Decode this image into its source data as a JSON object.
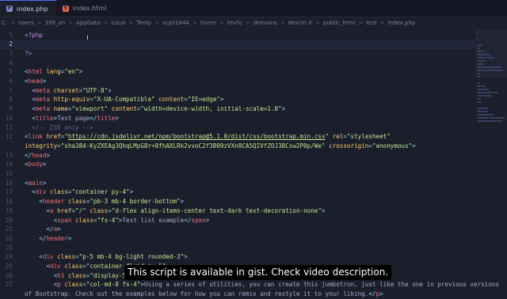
{
  "tabs": [
    {
      "label": "index.php",
      "icon": "php-icon",
      "active": true
    },
    {
      "label": "index.html",
      "icon": "html-icon",
      "active": false
    }
  ],
  "breadcrumb": [
    "C:",
    "Users",
    "399_an",
    "AppData",
    "Local",
    "Temp",
    "scp01644",
    "home",
    "tmrfo",
    "domains",
    "devcm.it",
    "public_html",
    "test",
    "index.php"
  ],
  "lines": [
    {
      "n": "1",
      "html": "<span class='ph'>&lt;?php</span>"
    },
    {
      "n": "2",
      "html": ""
    },
    {
      "n": "3",
      "html": "<span class='ph'>?&gt;</span>"
    },
    {
      "n": "4",
      "html": ""
    },
    {
      "n": "5",
      "html": "<span class='pn'>&lt;</span><span class='tg'>html</span> <span class='at'>lang</span><span class='pn'>=</span><span class='st'>\"en\"</span><span class='pn'>&gt;</span>"
    },
    {
      "n": "6",
      "html": "<span class='pn'>&lt;</span><span class='tg'>head</span><span class='pn'>&gt;</span>"
    },
    {
      "n": "7",
      "html": "  <span class='pn'>&lt;</span><span class='tg'>meta</span> <span class='at'>charset</span><span class='pn'>=</span><span class='st'>\"UTF-8\"</span><span class='pn'>&gt;</span>"
    },
    {
      "n": "8",
      "html": "  <span class='pn'>&lt;</span><span class='tg'>meta</span> <span class='at'>http-equiv</span><span class='pn'>=</span><span class='st'>\"X-UA-Compatible\"</span> <span class='at'>content</span><span class='pn'>=</span><span class='st'>\"IE=edge\"</span><span class='pn'>&gt;</span>"
    },
    {
      "n": "9",
      "html": "  <span class='pn'>&lt;</span><span class='tg'>meta</span> <span class='at'>name</span><span class='pn'>=</span><span class='st'>\"viewport\"</span> <span class='at'>content</span><span class='pn'>=</span><span class='st'>\"width=device-width, initial-scale=1.0\"</span><span class='pn'>&gt;</span>"
    },
    {
      "n": "10",
      "html": "  <span class='pn'>&lt;</span><span class='tg'>title</span><span class='pn'>&gt;</span><span class='tx'>Test page</span><span class='pn'>&lt;/</span><span class='tg'>title</span><span class='pn'>&gt;</span>"
    },
    {
      "n": "11",
      "html": "  <span class='cm'>&lt;!-- CSS only --&gt;</span>"
    },
    {
      "n": "12",
      "html": "<span class='pn'>&lt;</span><span class='tg'>link</span> <span class='at'>href</span><span class='pn'>=</span><span class='st'>\"</span><span class='ul'>https://cdn.jsdelivr.net/npm/bootstrap@5.1.0/dist/css/bootstrap.min.css</span><span class='st'>\"</span> <span class='at'>rel</span><span class='pn'>=</span><span class='st'>\"stylesheet\"</span>"
    },
    {
      "n": "",
      "html": "<span class='at'>integrity</span><span class='pn'>=</span><span class='st'>\"sha384-KyZXEAg3QhqLMpG8r+8fhAXLRk2vvoC2f3B09zVXn8CA5QIVfZOJ3BCsw2P0p/We\"</span> <span class='at'>crossorigin</span><span class='pn'>=</span><span class='st'>\"anonymous\"</span><span class='pn'>&gt;</span>"
    },
    {
      "n": "13",
      "html": "<span class='pn'>&lt;/</span><span class='tg'>head</span><span class='pn'>&gt;</span>"
    },
    {
      "n": "14",
      "html": "<span class='pn'>&lt;</span><span class='tg'>body</span><span class='pn'>&gt;</span>"
    },
    {
      "n": "15",
      "html": ""
    },
    {
      "n": "16",
      "html": "<span class='pn'>&lt;</span><span class='tg'>main</span><span class='pn'>&gt;</span>"
    },
    {
      "n": "17",
      "html": "  <span class='pn'>&lt;</span><span class='tg'>div</span> <span class='at'>class</span><span class='pn'>=</span><span class='st'>\"container py-4\"</span><span class='pn'>&gt;</span>"
    },
    {
      "n": "18",
      "html": "    <span class='pn'>&lt;</span><span class='tg'>header</span> <span class='at'>class</span><span class='pn'>=</span><span class='st'>\"pb-3 mb-4 border-bottom\"</span><span class='pn'>&gt;</span>"
    },
    {
      "n": "19",
      "html": "      <span class='pn'>&lt;</span><span class='tg'>a</span> <span class='at'>href</span><span class='pn'>=</span><span class='st'>\"/\"</span> <span class='at'>class</span><span class='pn'>=</span><span class='st'>\"d-flex align-items-center text-dark text-decoration-none\"</span><span class='pn'>&gt;</span>"
    },
    {
      "n": "20",
      "html": "        <span class='pn'>&lt;</span><span class='tg'>span</span> <span class='at'>class</span><span class='pn'>=</span><span class='st'>\"fs-4\"</span><span class='pn'>&gt;</span><span class='tx'>Test list example</span><span class='pn'>&lt;/</span><span class='tg'>span</span><span class='pn'>&gt;</span>"
    },
    {
      "n": "21",
      "html": "      <span class='pn'>&lt;/</span><span class='tg'>a</span><span class='pn'>&gt;</span>"
    },
    {
      "n": "22",
      "html": "    <span class='pn'>&lt;/</span><span class='tg'>header</span><span class='pn'>&gt;</span>"
    },
    {
      "n": "23",
      "html": ""
    },
    {
      "n": "24",
      "html": "    <span class='pn'>&lt;</span><span class='tg'>div</span> <span class='at'>class</span><span class='pn'>=</span><span class='st'>\"p-5 mb-4 bg-light rounded-3\"</span><span class='pn'>&gt;</span>"
    },
    {
      "n": "25",
      "html": "      <span class='pn'>&lt;</span><span class='tg'>div</span> <span class='at'>class</span><span class='pn'>=</span><span class='st'>\"container-fluid py-5\"</span><span class='pn'>&gt;</span>"
    },
    {
      "n": "26",
      "html": "        <span class='pn'>&lt;</span><span class='tg'>h1</span> <span class='at'>class</span><span class='pn'>=</span><span class='st'>\"display-5 fw-bold\"</span><span class='pn'>&gt;</span><span class='tx'>Custom jumbotron</span><span class='pn'>&lt;/</span><span class='tg'>h1</span><span class='pn'>&gt;</span>"
    },
    {
      "n": "27",
      "html": "        <span class='pn'>&lt;</span><span class='tg'>p</span> <span class='at'>class</span><span class='pn'>=</span><span class='st'>\"col-md-8 fs-4\"</span><span class='pn'>&gt;</span><span class='tx'>Using a series of utilities, you can create this jumbotron, just like the one in previous versions</span>"
    },
    {
      "n": "",
      "html": "<span class='tx'>of Bootstrap. Check out the examples below for how you can remix and restyle it to your liking.</span><span class='pn'>&lt;/</span><span class='tg'>p</span><span class='pn'>&gt;</span>"
    }
  ],
  "subtitle": "This script is available in gist. Check video description."
}
